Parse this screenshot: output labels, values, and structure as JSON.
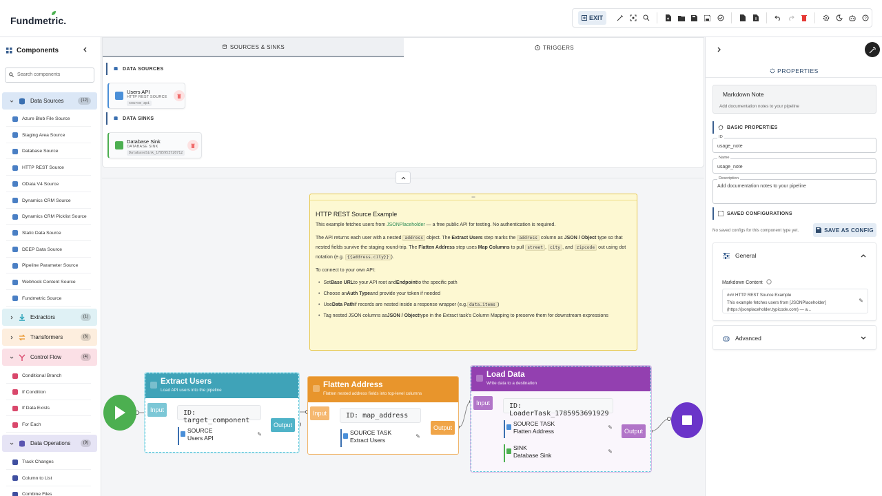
{
  "header": {
    "logo": "Fundmetric.",
    "exit_label": "EXIT",
    "toolbar_icons": [
      "wand-icon",
      "fit-view-icon",
      "zoom-icon",
      "new-file-icon",
      "open-folder-icon",
      "save-icon",
      "save-as-icon",
      "validate-icon",
      "export-icon",
      "import-icon",
      "undo-icon",
      "redo-icon",
      "delete-icon",
      "settings-icon",
      "theme-icon",
      "bot-icon",
      "help-icon"
    ]
  },
  "sidebar": {
    "title": "Components",
    "search_placeholder": "Search components",
    "categories": [
      {
        "label": "Data Sources",
        "count": "(12)",
        "color": "#dbe7f6"
      },
      {
        "label": "Extractors",
        "count": "(1)",
        "color": "#dff1f5"
      },
      {
        "label": "Transformers",
        "count": "(6)",
        "color": "#fdeede"
      },
      {
        "label": "Control Flow",
        "count": "(4)",
        "color": "#fbe0e6"
      },
      {
        "label": "Data Operations",
        "count": "(9)",
        "color": "#e6e4f5"
      }
    ],
    "data_source_items": [
      "Azure Blob File Source",
      "Staging Area Source",
      "Database Source",
      "HTTP REST Source",
      "OData V4 Source",
      "Dynamics CRM Source",
      "Dynamics CRM Picklist Source",
      "Static Data Source",
      "DEEP Data Source",
      "Pipeline Parameter Source",
      "Webhook Content Source",
      "Fundmetric Source"
    ],
    "control_flow_items": [
      "Conditional Branch",
      "If Condition",
      "If Data Exists",
      "For Each"
    ],
    "data_op_items": [
      "Track Changes",
      "Column to List",
      "Combine Files"
    ]
  },
  "top_panel": {
    "tabs": [
      "SOURCES & SINKS",
      "TRIGGERS"
    ],
    "data_sources_label": "DATA SOURCES",
    "data_sinks_label": "DATA SINKS",
    "source_card": {
      "title": "Users API",
      "type": "HTTP REST SOURCE",
      "id": "source_api"
    },
    "sink_card": {
      "title": "Database Sink",
      "type": "DATABASE SINK",
      "id": "DatabaseSink_1785953720712"
    }
  },
  "note": {
    "title": "HTTP REST Source Example",
    "p1_a": "This example fetches users from ",
    "p1_link": "JSONPlaceholder",
    "p1_b": " — a free public API for testing. No authentication is required.",
    "p2_1": "The API returns each user with a nested ",
    "p2_code1": "address",
    "p2_2": " object. The ",
    "p2_b1": "Extract Users",
    "p2_3": " step marks the ",
    "p2_code2": "address",
    "p2_4": " column as ",
    "p2_b2": "JSON / Object",
    "p2_5": " type so that",
    "p2_6": "nested fields survive the staging round-trip. The ",
    "p2_b3": "Flatten Address",
    "p2_7": " step uses ",
    "p2_b4": "Map Columns",
    "p2_8": " to pull ",
    "p2_code3": "street",
    "p2_code4": "city",
    "p2_9": ", and ",
    "p2_code5": "zipcode",
    "p2_10": " out using dot",
    "p2_11": "notation (e.g. ",
    "p2_code6": "{{address.city}}",
    "p2_12": ").",
    "p3": "To connect to your own API:",
    "b1_a": "Set ",
    "b1_b": "Base URL",
    "b1_c": " to your API root and ",
    "b1_d": "Endpoint",
    "b1_e": " to the specific path",
    "b2_a": "Choose an ",
    "b2_b": "Auth Type",
    "b2_c": " and provide your token if needed",
    "b3_a": "Use ",
    "b3_b": "Data Path",
    "b3_c": " if records are nested inside a response wrapper (e.g. ",
    "b3_code": "data.items",
    "b3_d": ")",
    "b4_a": "Tag nested JSON columns as ",
    "b4_b": "JSON / Object",
    "b4_c": " type in the Extract task's Column Mapping to preserve them for downstream expressions"
  },
  "flow": {
    "nodes": [
      {
        "title": "Extract Users",
        "subtitle": "Load API users into the pipeline",
        "id_text": "ID: target_component",
        "ref1_label": "SOURCE",
        "ref1_value": "Users API",
        "color": "#3fa3b8"
      },
      {
        "title": "Flatten Address",
        "subtitle": "Flatten nested address fields into top-level columns",
        "id_text": "ID: map_address",
        "ref1_label": "SOURCE TASK",
        "ref1_value": "Extract Users",
        "color": "#e8952c"
      },
      {
        "title": "Load Data",
        "subtitle": "Write data to a destination",
        "id_text": "ID: LoaderTask_1785953691929",
        "ref1_label": "SOURCE TASK",
        "ref1_value": "Flatten Address",
        "ref2_label": "SINK",
        "ref2_value": "Database Sink",
        "color": "#9340b0"
      }
    ],
    "input_label": "Input",
    "output_label": "Output"
  },
  "properties": {
    "title": "PROPERTIES",
    "component_title": "Markdown Note",
    "component_desc": "Add documentation notes to your pipeline",
    "basic_label": "BASIC PROPERTIES",
    "id_label": "ID",
    "id_value": "usage_note",
    "name_label": "Name",
    "name_value": "usage_note",
    "desc_label": "Description",
    "desc_value": "Add documentation notes to your pipeline",
    "saved_label": "SAVED CONFIGURATIONS",
    "saved_empty": "No saved configs for this component type yet.",
    "save_button": "SAVE AS CONFIG",
    "general_label": "General",
    "markdown_label": "Markdown Content",
    "markdown_line1": "### HTTP REST Source Example",
    "markdown_line2": "This example fetches users from [JSONPlaceholder]",
    "markdown_line3": "(https://jsonplaceholder.typicode.com) — a...",
    "advanced_label": "Advanced"
  }
}
